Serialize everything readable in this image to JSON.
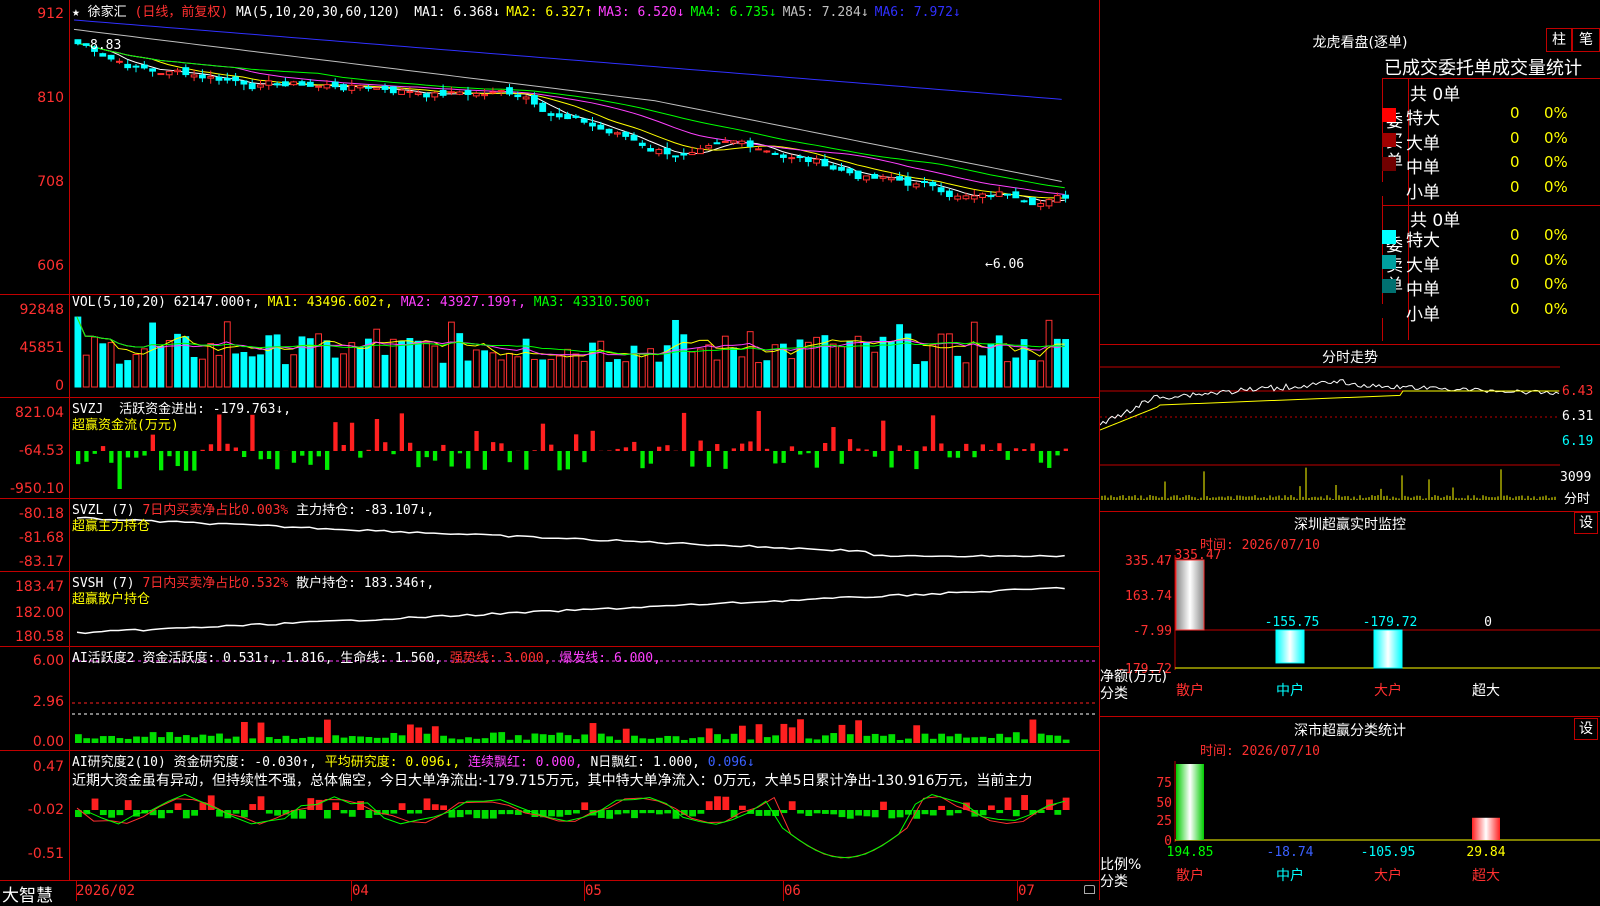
{
  "main_chart": {
    "stock": "徐家汇",
    "star": "★",
    "mode": "(日线，前复权)",
    "ma_spec": "MA(5,10,20,30,60,120)",
    "ma": [
      {
        "label": "MA1:",
        "value": "6.368",
        "arrow": "↓",
        "color": "#ffffff"
      },
      {
        "label": "MA2:",
        "value": "6.327",
        "arrow": "↑",
        "color": "#ffff00"
      },
      {
        "label": "MA3:",
        "value": "6.520",
        "arrow": "↓",
        "color": "#ff40ff"
      },
      {
        "label": "MA4:",
        "value": "6.735",
        "arrow": "↓",
        "color": "#00ff00"
      },
      {
        "label": "MA5:",
        "value": "7.284",
        "arrow": "↓",
        "color": "#c0c0c0"
      },
      {
        "label": "MA6:",
        "value": "7.972",
        "arrow": "↓",
        "color": "#3030ff"
      }
    ],
    "y_ticks": [
      "912",
      "810",
      "708",
      "606"
    ],
    "hi_label": "8.83",
    "lo_label": "←6.06"
  },
  "vol_panel": {
    "header": "VOL(5,10,20)",
    "value": "62147.000↑,",
    "ma1": "MA1: 43496.602↑,",
    "ma2": "MA2: 43927.199↑,",
    "ma3": "MA3: 43310.500↑",
    "y_ticks": [
      "92848",
      "45851",
      "0"
    ]
  },
  "svzj_panel": {
    "header": "SVZJ",
    "label": "活跃资金进出: -179.763↓,",
    "sub": "超赢资金流(万元)",
    "y_ticks": [
      "821.04",
      "-64.53",
      "-950.10"
    ]
  },
  "svzl_panel": {
    "header": "SVZL (7)",
    "ratio": "7日内买卖净占比0.003%",
    "label": "主力持仓: -83.107↓,",
    "sub": "超赢主力持仓",
    "y_ticks": [
      "-80.18",
      "-81.68",
      "-83.17"
    ]
  },
  "svsh_panel": {
    "header": "SVSH (7)",
    "ratio": "7日内买卖净占比0.532%",
    "label": "散户持仓: 183.346↑,",
    "sub": "超赢散户持仓",
    "y_ticks": [
      "183.47",
      "182.00",
      "180.58"
    ]
  },
  "ai_active_panel": {
    "header": "AI活跃度2",
    "l1": "资金活跃度: 0.531↑,",
    "l2": "1.816,",
    "l3": "生命线: 1.560,",
    "l4": "强势线: 3.000,",
    "l5": "爆发线: 6.000,",
    "y_ticks": [
      "6.00",
      "2.96",
      "0.00"
    ]
  },
  "ai_research_panel": {
    "header": "AI研究度2(10)",
    "l1": "资金研究度: -0.030↑,",
    "l2": "平均研究度: 0.096↓,",
    "l3": "连续飘红: 0.000,",
    "l4": "N日飘红: 1.000,",
    "l5": "0.096↓",
    "commentary": "近期大资金虽有异动，但持续性不强，总体偏空，今日大单净流出:-179.715万元，其中特大单净流入：0万元，大单5日累计净出-130.916万元，当前主力",
    "y_ticks": [
      "0.47",
      "-0.02",
      "-0.51"
    ]
  },
  "bottom_bar": {
    "brand": "大智慧",
    "dates": [
      "2026/02",
      "04",
      "05",
      "06",
      "07"
    ]
  },
  "dragon_tiger": {
    "title": "龙虎看盘(逐单)",
    "btn1": "柱",
    "btn2": "笔",
    "subtitle": "已成交委托单成交量统计",
    "buy_label": "委买单",
    "sell_label": "委卖单",
    "buy_total": "共 0单",
    "sell_total": "共 0单",
    "buy_rows": [
      {
        "name": "特大",
        "val": "0",
        "pct": "0%",
        "color": "#ff0000"
      },
      {
        "name": "大单",
        "val": "0",
        "pct": "0%",
        "color": "#a00000"
      },
      {
        "name": "中单",
        "val": "0",
        "pct": "0%",
        "color": "#700000"
      },
      {
        "name": "小单",
        "val": "0",
        "pct": "0%",
        "color": "#000000"
      }
    ],
    "sell_rows": [
      {
        "name": "特大",
        "val": "0",
        "pct": "0%",
        "color": "#00ffff"
      },
      {
        "name": "大单",
        "val": "0",
        "pct": "0%",
        "color": "#00a0a0"
      },
      {
        "name": "中单",
        "val": "0",
        "pct": "0%",
        "color": "#007070"
      },
      {
        "name": "小单",
        "val": "0",
        "pct": "0%",
        "color": "#000000"
      }
    ]
  },
  "intraday": {
    "title": "分时走势",
    "ticks": [
      "6.43",
      "6.31",
      "6.19"
    ],
    "vol_tick": "3099",
    "vol_unit": "分时"
  },
  "sz_monitor": {
    "title": "深圳超赢实时监控",
    "btn": "设",
    "time": "时间: 2026/07/10",
    "y_ticks": [
      "335.47",
      "163.74",
      "-7.99",
      "-179.72"
    ],
    "net_label": "净额(万元)",
    "cat_label": "分类",
    "bars": [
      {
        "cat": "散户",
        "value": 335.47,
        "label": "335.47"
      },
      {
        "cat": "中户",
        "value": -155.75,
        "label": "-155.75"
      },
      {
        "cat": "大户",
        "value": -179.72,
        "label": "-179.72"
      },
      {
        "cat": "超大",
        "value": 0,
        "label": "0"
      }
    ]
  },
  "sz_class": {
    "title": "深市超赢分类统计",
    "btn": "设",
    "time": "时间: 2026/07/10",
    "y_ticks": [
      "75",
      "50",
      "25",
      "0"
    ],
    "ratio_label": "比例%",
    "cat_label": "分类",
    "bars": [
      {
        "cat": "散户",
        "value": 194.85,
        "label": "194.85"
      },
      {
        "cat": "中户",
        "value": -18.74,
        "label": "-18.74"
      },
      {
        "cat": "大户",
        "value": -105.95,
        "label": "-105.95"
      },
      {
        "cat": "超大",
        "value": 29.84,
        "label": "29.84"
      }
    ]
  }
}
